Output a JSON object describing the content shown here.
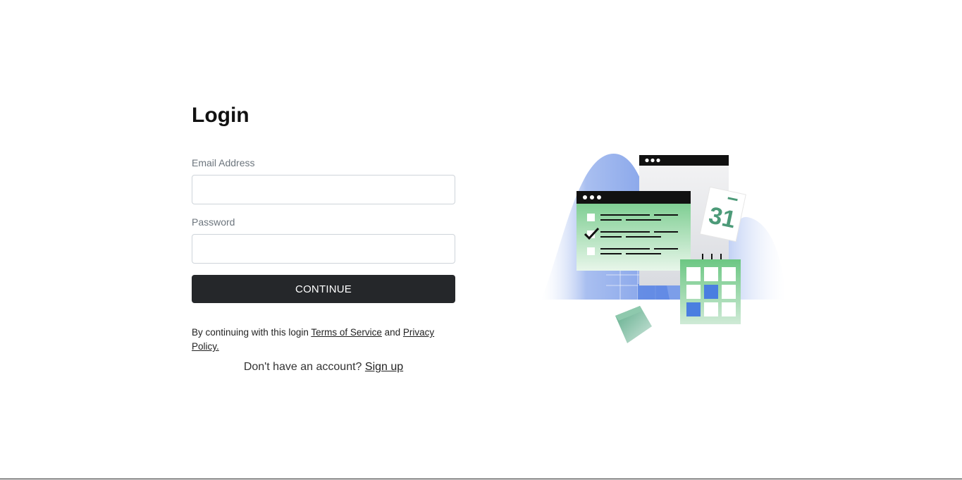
{
  "login": {
    "title": "Login",
    "email_label": "Email Address",
    "email_value": "",
    "password_label": "Password",
    "password_value": "",
    "continue_label": "CONTINUE",
    "terms_prefix": "By continuing with this login ",
    "terms_link": "Terms of Service",
    "terms_middle": " and ",
    "privacy_link": "Privacy Policy.",
    "signup_prefix": "Don't have an account? ",
    "signup_link": "Sign up"
  },
  "illustration": {
    "calendar_day": "31"
  },
  "colors": {
    "button_bg": "#25272a",
    "accent_green": "#5fbf7a",
    "accent_blue": "#4a7ee0"
  }
}
